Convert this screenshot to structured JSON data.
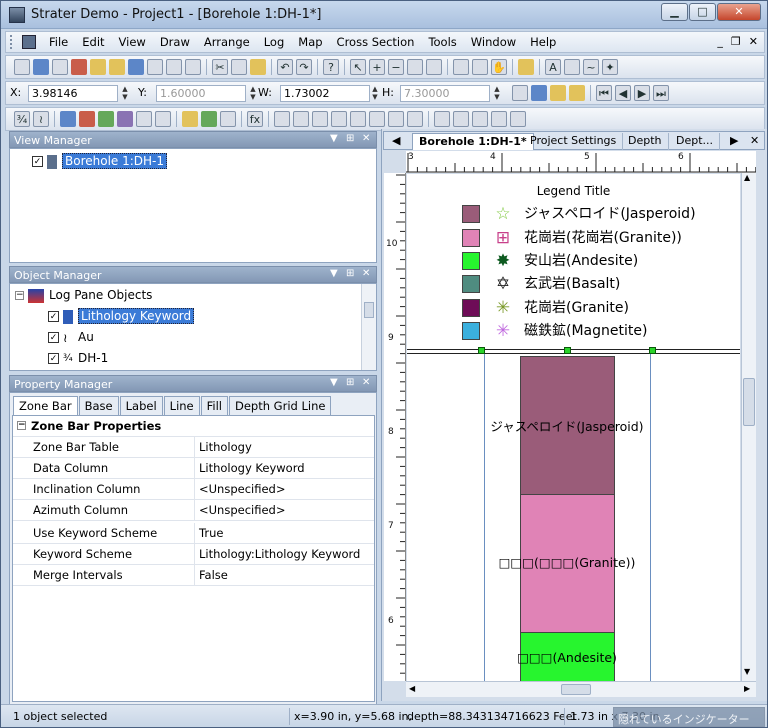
{
  "window": {
    "title": "Strater Demo - Project1 - [Borehole 1:DH-1*]",
    "btn_min": "▁",
    "btn_max": "□",
    "btn_close": "✕"
  },
  "menu": {
    "items": [
      "File",
      "Edit",
      "View",
      "Draw",
      "Arrange",
      "Log",
      "Map",
      "Cross Section",
      "Tools",
      "Window",
      "Help"
    ],
    "mdi": [
      "_",
      "❐",
      "✕"
    ]
  },
  "coords": {
    "x_label": "X:",
    "x_value": "3.98146",
    "y_label": "Y:",
    "y_value": "1.60000",
    "w_label": "W:",
    "w_value": "1.73002",
    "h_label": "H:",
    "h_value": "7.30000"
  },
  "view_manager": {
    "title": "View Manager",
    "item": "Borehole 1:DH-1",
    "btns": [
      "▼",
      "⊞",
      "✕"
    ]
  },
  "object_manager": {
    "title": "Object Manager",
    "root": "Log Pane Objects",
    "items": [
      "Lithology Keyword",
      "Au",
      "DH-1"
    ],
    "btns": [
      "▼",
      "⊞",
      "✕"
    ]
  },
  "property_manager": {
    "title": "Property Manager",
    "tabs": [
      "Zone Bar",
      "Base",
      "Label",
      "Line",
      "Fill",
      "Depth Grid Line"
    ],
    "group": "Zone Bar Properties",
    "rows": [
      {
        "k": "Zone Bar Table",
        "v": "Lithology"
      },
      {
        "k": "Data Column",
        "v": "Lithology Keyword"
      },
      {
        "k": "Inclination Column",
        "v": "<Unspecified>"
      },
      {
        "k": "Azimuth Column",
        "v": "<Unspecified>"
      },
      {
        "k": "Use Keyword Scheme",
        "v": "True"
      },
      {
        "k": "Keyword Scheme",
        "v": "Lithology:Lithology Keyword"
      },
      {
        "k": "Merge Intervals",
        "v": "False"
      }
    ],
    "btns": [
      "▼",
      "⊞",
      "✕"
    ]
  },
  "doc_tabs": [
    "Borehole 1:DH-1*",
    "Project Settings",
    "Depth",
    "Dept..."
  ],
  "ruler": {
    "h_labels": [
      "3",
      "4",
      "5",
      "6"
    ],
    "v_labels": [
      "10",
      "9",
      "8",
      "7",
      "6"
    ]
  },
  "legend": {
    "title": "Legend Title",
    "entries": [
      {
        "label": "ジャスペロイド(Jasperoid)",
        "color": "#9a5c79",
        "sym": "☆",
        "sym_color": "#7ec83c"
      },
      {
        "label": "花崗岩(花崗岩(Granite))",
        "color": "#e083b6",
        "sym": "⊞",
        "sym_color": "#c8408a"
      },
      {
        "label": "安山岩(Andesite)",
        "color": "#27f52e",
        "sym": "✸",
        "sym_color": "#0d5a20"
      },
      {
        "label": "玄武岩(Basalt)",
        "color": "#4f8c80",
        "sym": "✡",
        "sym_color": "#222222"
      },
      {
        "label": "花崗岩(Granite)",
        "color": "#6e0c57",
        "sym": "✳",
        "sym_color": "#7a9a28"
      },
      {
        "label": "磁鉄鉱(Magnetite)",
        "color": "#3bb0de",
        "sym": "✳",
        "sym_color": "#c06adf"
      }
    ]
  },
  "zones": [
    {
      "label": "ジャスペロイド(Jasperoid)",
      "color": "#9a5c79"
    },
    {
      "label": "□□□(□□□(Granite))",
      "color": "#e083b6"
    },
    {
      "label": "□□□(Andesite)",
      "color": "#27f52e"
    }
  ],
  "status": {
    "left": "1 object selected",
    "coords": "x=3.90 in, y=5.68 in,",
    "depth": "depth=88.343134716623 Feet",
    "size": "1.73 in x 7.30 in",
    "hidden": "隠れているインジケーター"
  }
}
